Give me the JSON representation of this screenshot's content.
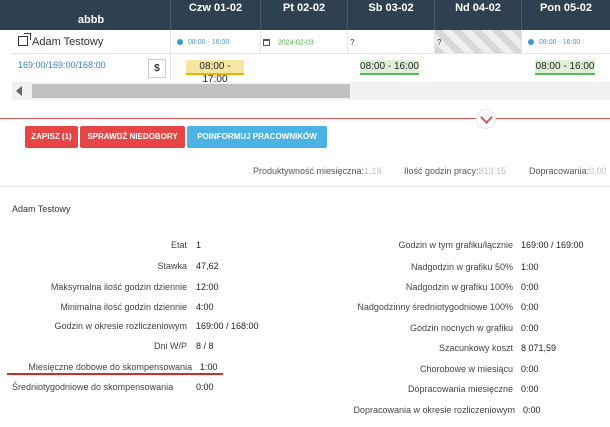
{
  "grid": {
    "group_label": "abbb",
    "days": [
      "Czw 01-02",
      "Pt 02-02",
      "Sb 03-02",
      "Nd 04-02",
      "Pon 05-02"
    ],
    "employee": "Adam Testowy",
    "row1": {
      "d1": "08:00 - 16:00",
      "d2": "2024-02-03",
      "d3": "?",
      "d4": "?",
      "d5": "08:00 - 16:00"
    },
    "hours": "169:00/169:00/168:00",
    "currency": "$",
    "shifts": {
      "d1": "08:00 - 17:00",
      "d3": "08:00 - 16:00",
      "d5": "08:00 - 16:00"
    }
  },
  "actions": {
    "save": "ZAPISZ (1)",
    "check": "SPRAWDŹ NIEDOBORY",
    "notify": "POINFORMUJ PRACOWNIKÓW"
  },
  "stats": {
    "productivity_label": "Produktywność miesięczna:",
    "productivity_value": "1,18",
    "hours_label": "Ilość godzin pracy:",
    "hours_value": "813:15",
    "extra_label": "Dopracowania:",
    "extra_value": "0,00"
  },
  "details": {
    "employee": "Adam Testowy",
    "left": [
      {
        "label": "Etat",
        "value": "1"
      },
      {
        "label": "Stawka",
        "value": "47,62"
      },
      {
        "label": "Maksymalna ilość godzin dziennie",
        "value": "12:00"
      },
      {
        "label": "Minimalna ilość godzin dziennie",
        "value": "4:00"
      },
      {
        "label": "Godzin w okresie rozliczeniowym",
        "value": "169:00 / 168:00"
      },
      {
        "label": "Dni W/P",
        "value": "8 / 8"
      },
      {
        "label": "Miesięczne dobowe do skompensowania",
        "value": "1:00"
      },
      {
        "label": "Średniotygodniowe do skompensowania",
        "value": "0:00"
      }
    ],
    "right": [
      {
        "label": "Godzin w tym grafiku/łącznie",
        "value": "169:00 / 169:00"
      },
      {
        "label": "Nadgodzin w grafiku 50%",
        "value": "1:00"
      },
      {
        "label": "Nadgodzin w grafiku 100%",
        "value": "0:00"
      },
      {
        "label": "Nadgodzinny średniotygodniowe 100%",
        "value": "0:00"
      },
      {
        "label": "Godzin nocnych w grafiku",
        "value": "0:00"
      },
      {
        "label": "Szacunkowy koszt",
        "value": "8 071,59"
      },
      {
        "label": "Chorobowe w miesiącu",
        "value": "0:00"
      },
      {
        "label": "Dopracowania miesięczne",
        "value": "0:00"
      },
      {
        "label": "Dopracowania w okresie rozliczeniowym",
        "value": "0:00"
      }
    ]
  }
}
